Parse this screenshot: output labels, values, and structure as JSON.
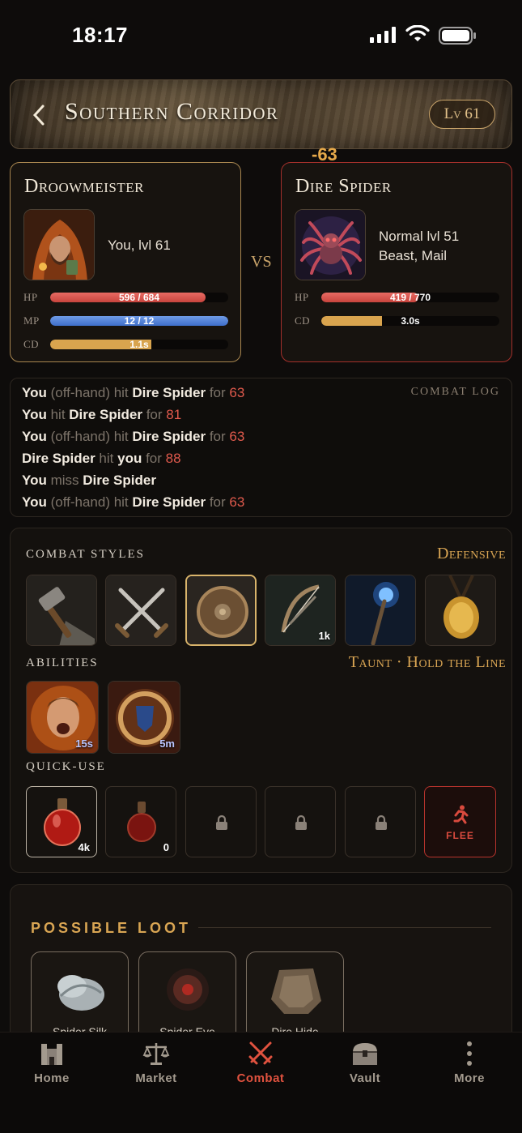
{
  "status": {
    "time": "18:17"
  },
  "header": {
    "back_icon": "chevron-left-icon",
    "title": "Southern Corridor",
    "level_badge": "Lv 61"
  },
  "damage_float": "-63",
  "player": {
    "name": "Droowmeister",
    "subtitle": "You, lvl 61",
    "hp": {
      "label": "HP",
      "text": "596 / 684",
      "fraction": 0.871
    },
    "mp": {
      "label": "MP",
      "text": "12 / 12",
      "fraction": 1.0
    },
    "cd": {
      "label": "CD",
      "text": "1.1s",
      "fraction": 0.57
    }
  },
  "vs_label": "VS",
  "enemy": {
    "name": "Dire Spider",
    "subtitle_line1": "Normal lvl 51",
    "subtitle_line2": "Beast, Mail",
    "hp": {
      "label": "HP",
      "text": "419 / 770",
      "fraction": 0.544
    },
    "cd": {
      "label": "CD",
      "text": "3.0s",
      "fraction": 0.34
    }
  },
  "combat_log": {
    "title": "COMBAT LOG",
    "lines": [
      [
        [
          "b",
          "You"
        ],
        [
          "t",
          " (off-hand) hit "
        ],
        [
          "b",
          "Dire Spider"
        ],
        [
          "t",
          " for "
        ],
        [
          "n",
          "63"
        ]
      ],
      [
        [
          "b",
          "You"
        ],
        [
          "t",
          " hit "
        ],
        [
          "b",
          "Dire Spider"
        ],
        [
          "t",
          " for "
        ],
        [
          "n",
          "81"
        ]
      ],
      [
        [
          "b",
          "You"
        ],
        [
          "t",
          " (off-hand) hit "
        ],
        [
          "b",
          "Dire Spider"
        ],
        [
          "t",
          " for "
        ],
        [
          "n",
          "63"
        ]
      ],
      [
        [
          "b",
          "Dire Spider"
        ],
        [
          "t",
          " hit "
        ],
        [
          "b",
          "you"
        ],
        [
          "t",
          " for "
        ],
        [
          "n",
          "88"
        ]
      ],
      [
        [
          "b",
          "You"
        ],
        [
          "t",
          " miss "
        ],
        [
          "b",
          "Dire Spider"
        ]
      ],
      [
        [
          "b",
          "You"
        ],
        [
          "t",
          " (off-hand) hit "
        ],
        [
          "b",
          "Dire Spider"
        ],
        [
          "t",
          " for "
        ],
        [
          "n",
          "63"
        ]
      ]
    ]
  },
  "combat_styles": {
    "label": "COMBAT STYLES",
    "selected_name": "Defensive",
    "slots": [
      {
        "icon": "hammer-stone-icon",
        "count": ""
      },
      {
        "icon": "crossed-swords-icon",
        "count": ""
      },
      {
        "icon": "shield-icon",
        "count": ""
      },
      {
        "icon": "bow-icon",
        "count": "1k"
      },
      {
        "icon": "magic-staff-icon",
        "count": ""
      },
      {
        "icon": "amulet-icon",
        "count": ""
      }
    ]
  },
  "abilities": {
    "label": "ABILITIES",
    "active_names": "Taunt · Hold the Line",
    "slots": [
      {
        "icon": "shouting-warrior-icon",
        "cooldown": "15s"
      },
      {
        "icon": "shield-aura-icon",
        "cooldown": "5m"
      }
    ]
  },
  "quick_use": {
    "label": "QUICK-USE",
    "slots": [
      {
        "icon": "health-potion-icon",
        "count": "4k"
      },
      {
        "icon": "small-potion-icon",
        "count": "0"
      }
    ],
    "locked_slots": 3,
    "flee_label": "FLEE"
  },
  "loot": {
    "title": "POSSIBLE LOOT",
    "items": [
      {
        "name": "Spider Silk",
        "icon": "silk-icon"
      },
      {
        "name": "Spider Eye",
        "icon": "spider-eye-icon"
      },
      {
        "name": "Dire Hide",
        "icon": "hide-icon"
      }
    ]
  },
  "nav": {
    "items": [
      {
        "label": "Home",
        "icon": "castle-icon"
      },
      {
        "label": "Market",
        "icon": "scales-icon"
      },
      {
        "label": "Combat",
        "icon": "crossed-swords-icon",
        "active": true
      },
      {
        "label": "Vault",
        "icon": "chest-icon"
      },
      {
        "label": "More",
        "icon": "more-vertical-icon"
      }
    ]
  },
  "colors": {
    "accent": "#d9a553",
    "danger": "#e0523f",
    "hp": "#d6514a",
    "mp": "#4f80d8",
    "cd": "#d9a44e"
  }
}
